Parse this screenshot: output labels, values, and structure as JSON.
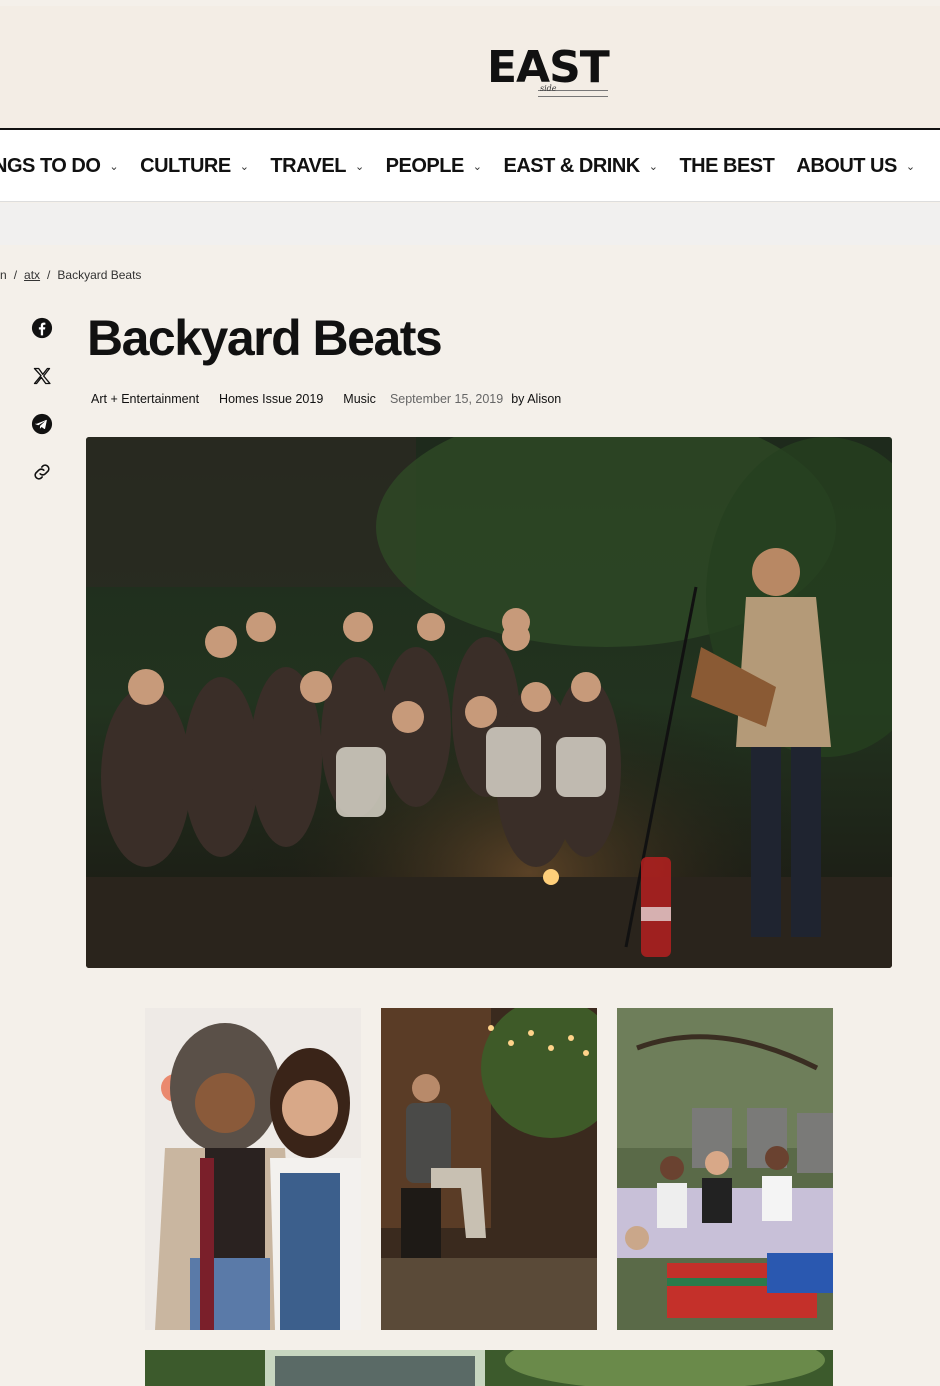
{
  "site": {
    "logo_text": "EAST",
    "logo_sub": "side"
  },
  "nav": {
    "items": [
      {
        "label": "INGS TO DO",
        "has_dropdown": true
      },
      {
        "label": "CULTURE",
        "has_dropdown": true
      },
      {
        "label": "TRAVEL",
        "has_dropdown": true
      },
      {
        "label": "PEOPLE",
        "has_dropdown": true
      },
      {
        "label": "EAST & DRINK",
        "has_dropdown": true
      },
      {
        "label": "THE BEST",
        "has_dropdown": false
      },
      {
        "label": "ABOUT US",
        "has_dropdown": true
      }
    ],
    "chevron": "⌄"
  },
  "breadcrumb": {
    "first": "n",
    "second": "atx",
    "current": "Backyard Beats",
    "separator": "/"
  },
  "share": {
    "icons": [
      "facebook-icon",
      "x-icon",
      "telegram-icon",
      "link-icon"
    ]
  },
  "article": {
    "title": "Backyard Beats",
    "categories": [
      "Art + Entertainment",
      "Homes Issue 2019",
      "Music"
    ],
    "date": "September 15, 2019",
    "author": "by Alison"
  },
  "images": {
    "hero_alt": "Musician playing guitar for seated crowd at night in backyard",
    "gallery": [
      "Two women smiling",
      "Guitar player with string lights",
      "Group sitting on blankets outdoors"
    ]
  },
  "colors": {
    "page_bg": "#f4f0ea",
    "nav_bg": "#ffffff",
    "text": "#111111",
    "muted": "#666666"
  }
}
